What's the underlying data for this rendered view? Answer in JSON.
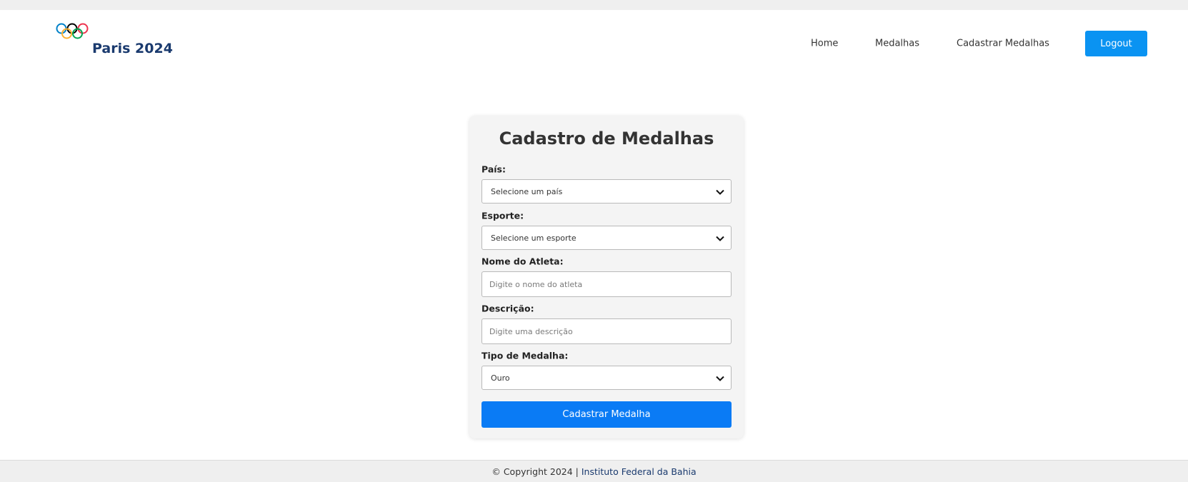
{
  "header": {
    "brand": "Paris 2024",
    "nav": [
      {
        "label": "Home"
      },
      {
        "label": "Medalhas"
      },
      {
        "label": "Cadastrar Medalhas"
      }
    ],
    "logout_label": "Logout",
    "ring_colors": [
      "#0081c8",
      "#fcb131",
      "#000000",
      "#00a651",
      "#ee334e"
    ]
  },
  "form": {
    "title": "Cadastro de Medalhas",
    "pais_label": "País:",
    "pais_value": "Selecione um país",
    "esporte_label": "Esporte:",
    "esporte_value": "Selecione um esporte",
    "atleta_label": "Nome do Atleta:",
    "atleta_placeholder": "Digite o nome do atleta",
    "descricao_label": "Descrição:",
    "descricao_placeholder": "Digite uma descrição",
    "tipo_label": "Tipo de Medalha:",
    "tipo_value": "Ouro",
    "submit_label": "Cadastrar Medalha"
  },
  "footer": {
    "copyright": "© Copyright 2024 |",
    "institution": "Instituto Federal da Bahia"
  },
  "colors": {
    "primary_button": "#0a7bf5",
    "logout_button": "#0a93f2",
    "brand_text": "#1a3a6e"
  }
}
